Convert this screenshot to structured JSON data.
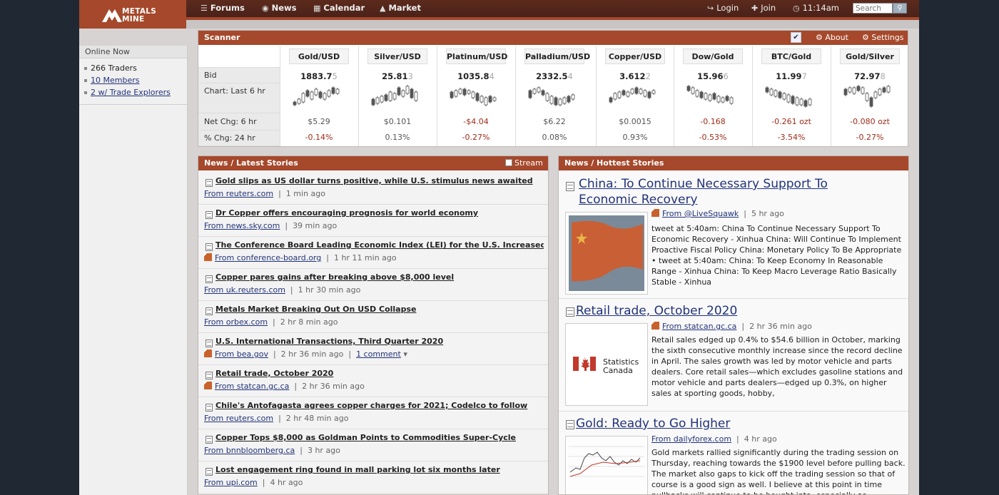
{
  "header": {
    "logo_line1": "METALS",
    "logo_line2": "MINE",
    "nav": [
      {
        "label": "Forums",
        "icon": "chat-bubbles-icon"
      },
      {
        "label": "News",
        "icon": "globe-icon"
      },
      {
        "label": "Calendar",
        "icon": "calendar-icon"
      },
      {
        "label": "Market",
        "icon": "chart-icon"
      }
    ],
    "login": "Login",
    "join": "Join",
    "time": "11:14am",
    "search_placeholder": "Search"
  },
  "online": {
    "title": "Online Now",
    "items": [
      "266 Traders",
      "10 Members",
      "2 w/ Trade Explorers"
    ]
  },
  "scanner": {
    "title": "Scanner",
    "about": "About",
    "settings": "Settings",
    "row_labels": [
      "Bid",
      "Chart: Last 6 hr",
      "Net Chg: 6 hr",
      "% Chg: 24 hr"
    ],
    "columns": [
      {
        "symbol": "Gold/USD",
        "bid_main": "1883.7",
        "bid_tail": "5",
        "net_chg": "$5.29",
        "pct_chg": "-0.14%",
        "net_dir": "pos",
        "pct_dir": "neg"
      },
      {
        "symbol": "Silver/USD",
        "bid_main": "25.81",
        "bid_tail": "3",
        "net_chg": "$0.101",
        "pct_chg": "0.13%",
        "net_dir": "pos",
        "pct_dir": "pos"
      },
      {
        "symbol": "Platinum/USD",
        "bid_main": "1035.8",
        "bid_tail": "4",
        "net_chg": "-$4.04",
        "pct_chg": "-0.27%",
        "net_dir": "neg",
        "pct_dir": "neg"
      },
      {
        "symbol": "Palladium/USD",
        "bid_main": "2332.5",
        "bid_tail": "4",
        "net_chg": "$6.22",
        "pct_chg": "0.08%",
        "net_dir": "pos",
        "pct_dir": "pos"
      },
      {
        "symbol": "Copper/USD",
        "bid_main": "3.612",
        "bid_tail": "2",
        "net_chg": "$0.0015",
        "pct_chg": "0.93%",
        "net_dir": "pos",
        "pct_dir": "pos"
      },
      {
        "symbol": "Dow/Gold",
        "bid_main": "15.96",
        "bid_tail": "6",
        "net_chg": "-0.168",
        "pct_chg": "-0.53%",
        "net_dir": "neg",
        "pct_dir": "neg"
      },
      {
        "symbol": "BTC/Gold",
        "bid_main": "11.99",
        "bid_tail": "7",
        "net_chg": "-0.261 ozt",
        "pct_chg": "-3.54%",
        "net_dir": "neg",
        "pct_dir": "neg"
      },
      {
        "symbol": "Gold/Silver",
        "bid_main": "72.97",
        "bid_tail": "8",
        "net_chg": "-0.080 ozt",
        "pct_chg": "-0.27%",
        "net_dir": "neg",
        "pct_dir": "neg"
      }
    ]
  },
  "latest": {
    "title": "News / Latest Stories",
    "stream": "Stream",
    "stories": [
      {
        "title": "Gold slips as US dollar turns positive, while U.S. stimulus news awaited",
        "source": "From reuters.com",
        "age": "1 min ago",
        "rss": false,
        "extra": ""
      },
      {
        "title": "Dr Copper offers encouraging prognosis for world economy",
        "source": "From news.sky.com",
        "age": "39 min ago",
        "rss": false,
        "extra": ""
      },
      {
        "title": "The Conference Board Leading Economic Index (LEI) for the U.S. Increased in O",
        "source": "From conference-board.org",
        "age": "1 hr 11 min ago",
        "rss": true,
        "extra": ""
      },
      {
        "title": "Copper pares gains after breaking above $8,000 level",
        "source": "From uk.reuters.com",
        "age": "1 hr 30 min ago",
        "rss": false,
        "extra": ""
      },
      {
        "title": "Metals Market Breaking Out On USD Collapse",
        "source": "From orbex.com",
        "age": "2 hr 8 min ago",
        "rss": false,
        "extra": ""
      },
      {
        "title": "U.S. International Transactions, Third Quarter 2020",
        "source": "From bea.gov",
        "age": "2 hr 36 min ago",
        "rss": true,
        "extra": "1 comment"
      },
      {
        "title": "Retail trade, October 2020",
        "source": "From statcan.gc.ca",
        "age": "2 hr 36 min ago",
        "rss": true,
        "extra": ""
      },
      {
        "title": "Chile's Antofagasta agrees copper charges for 2021; Codelco to follow",
        "source": "From reuters.com",
        "age": "2 hr 48 min ago",
        "rss": false,
        "extra": ""
      },
      {
        "title": "Copper Tops $8,000 as Goldman Points to Commodities Super-Cycle",
        "source": "From bnnbloomberg.ca",
        "age": "3 hr ago",
        "rss": false,
        "extra": ""
      },
      {
        "title": "Lost engagement ring found in mall parking lot six months later",
        "source": "From upi.com",
        "age": "4 hr ago",
        "rss": false,
        "extra": ""
      }
    ]
  },
  "hottest": {
    "title": "News / Hottest Stories",
    "stories": [
      {
        "title_line1": "China: To Continue Necessary Support To",
        "title_line2": "Economic Recovery",
        "source": "From @LiveSquawk",
        "age": "5 hr ago",
        "rss": true,
        "body": "tweet at 5:40am: China To Continue Necessary Support To Economic Recovery - Xinhua China: Will Continue To Implement Proactive Fiscal Policy China: Monetary Policy To Be Appropriate • tweet at 5:40am: China: To Keep Economy In Reasonable Range - Xinhua China: To Keep Macro Leverage Ratio Basically Stable - Xinhua"
      },
      {
        "title_line1": "Retail trade, October 2020",
        "title_line2": "",
        "source": "From statcan.gc.ca",
        "age": "2 hr 36 min ago",
        "rss": true,
        "thumb_line1": "Statistics",
        "thumb_line2": "Canada",
        "body": "Retail sales edged up 0.4% to $54.6 billion in October, marking the sixth consecutive monthly increase since the record decline in April. The sales growth was led by motor vehicle and parts dealers. Core retail sales—which excludes gasoline stations and motor vehicle and parts dealers—edged up 0.3%, on higher sales at sporting goods, hobby,"
      },
      {
        "title_line1": "Gold: Ready to Go Higher",
        "title_line2": "",
        "source": "From dailyforex.com",
        "age": "4 hr ago",
        "rss": false,
        "body": "Gold markets rallied significantly during the trading session on Thursday, reaching towards the $1900 level before pulling back. The market also gaps to kick off the trading session so that of course is a good sign as well. I believe at this point in time pullbacks will continue to be bought into, especially as"
      }
    ]
  }
}
